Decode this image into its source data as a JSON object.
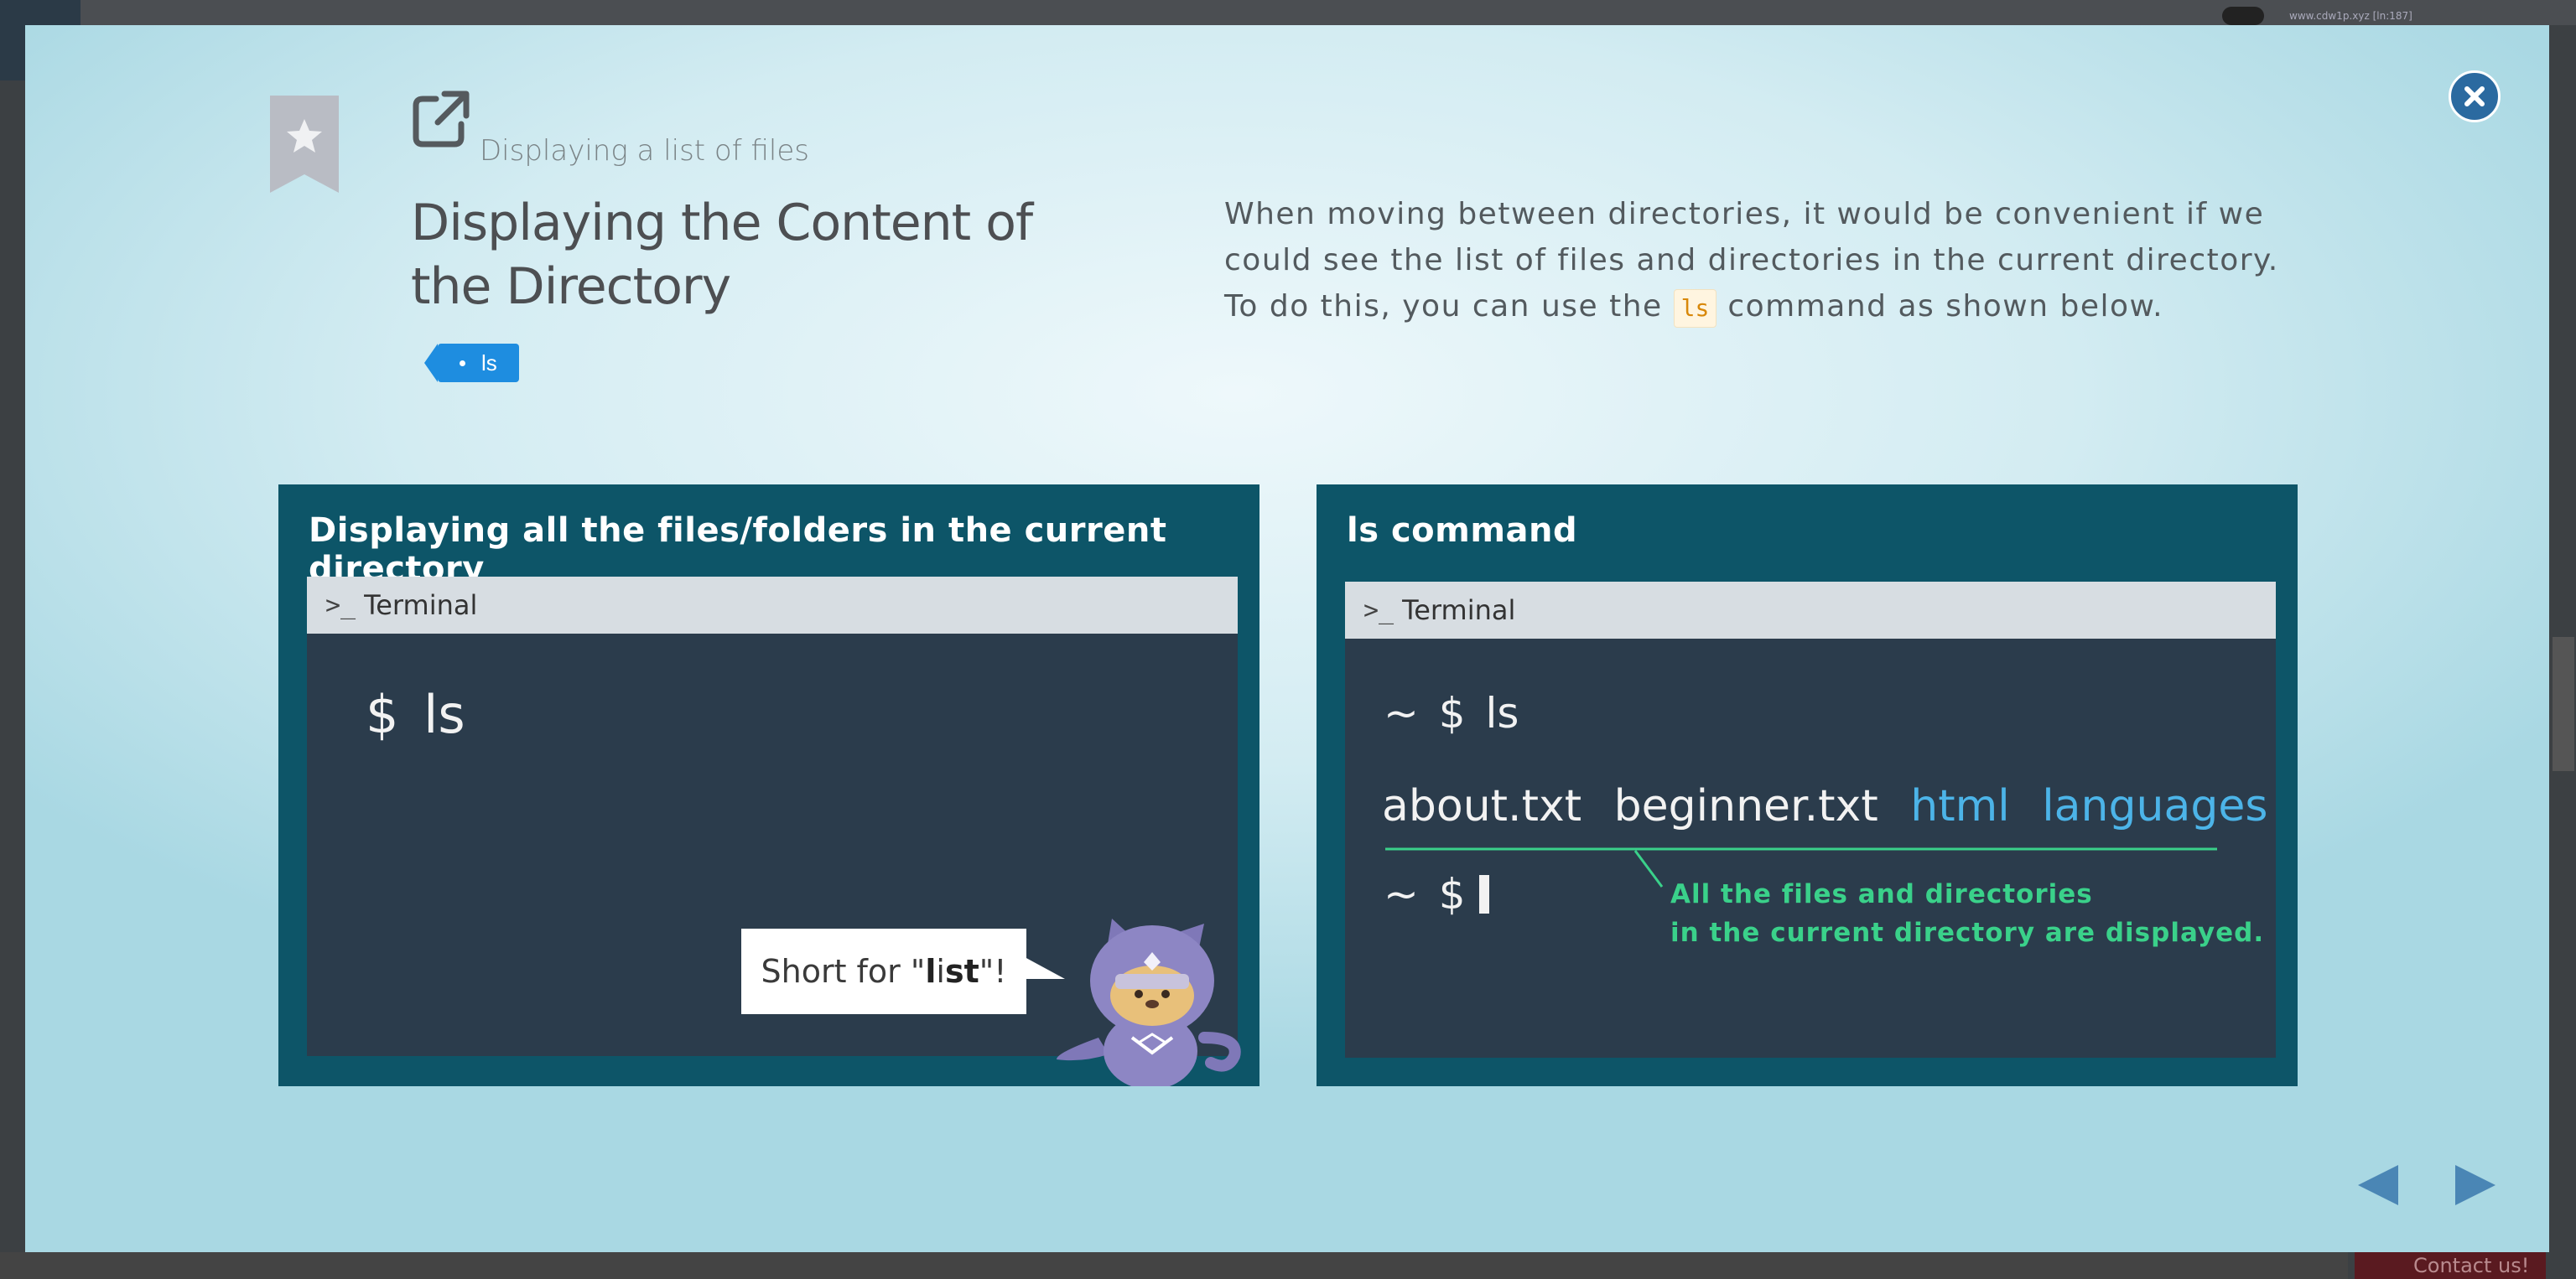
{
  "background": {
    "url_text": "www.cdw1p.xyz [ln:187]",
    "contact_label": "Contact us!"
  },
  "modal": {
    "subtitle": "Displaying a list of files",
    "title": "Displaying the Content of the Directory",
    "tag": "ls",
    "description": {
      "line1": "When moving between directories, it would be convenient if we could see the list of files and directories in the current directory.",
      "line2_before": "To do this, you can use the",
      "line2_code": "ls",
      "line2_after": "command as shown below."
    },
    "slides": [
      {
        "heading": "Displaying all the files/folders in the current directory",
        "terminal_label": "Terminal",
        "command": "$ ls",
        "bubble_prefix": "Short for \"",
        "bubble_l": "l",
        "bubble_i": "i",
        "bubble_st": "st",
        "bubble_suffix": "\"!"
      },
      {
        "heading": "ls command",
        "terminal_label": "Terminal",
        "prompt_line": "~ $ ls",
        "files": [
          "about.txt",
          "beginner.txt"
        ],
        "directories": [
          "html",
          "languages"
        ],
        "prompt_line2": "~ $",
        "callout_line1": "All the files and directories",
        "callout_line2": "in the current directory are displayed."
      }
    ]
  },
  "colors": {
    "accent": "#1e8de0",
    "slide_bg": "#0d5568",
    "terminal_bg": "#2b3c4c",
    "directory_text": "#4cb4e8",
    "callout_text": "#3ad18a",
    "close_button": "#2b6aa0",
    "nav_arrow": "#4a86b5"
  },
  "icons": {
    "close": "close-icon",
    "bookmark": "bookmark-star-icon",
    "external": "external-link-icon",
    "terminal": "terminal-prompt-icon",
    "prev": "triangle-left-icon",
    "next": "triangle-right-icon"
  }
}
